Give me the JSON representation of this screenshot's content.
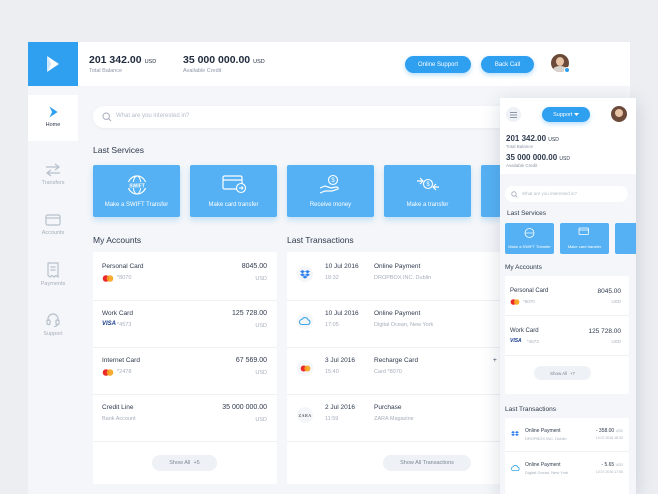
{
  "topbar": {
    "total_balance_value": "201 342.00",
    "total_balance_currency": "USD",
    "total_balance_label": "Total Balance",
    "available_credit_value": "35 000 000.00",
    "available_credit_currency": "USD",
    "available_credit_label": "Available Credit",
    "online_support_label": "Online Support",
    "back_call_label": "Back Call"
  },
  "sidebar": {
    "items": [
      {
        "label": "Home",
        "icon": "logo-icon"
      },
      {
        "label": "Transfers",
        "icon": "transfer-icon"
      },
      {
        "label": "Accounts",
        "icon": "card-icon"
      },
      {
        "label": "Payments",
        "icon": "receipt-icon"
      },
      {
        "label": "Support",
        "icon": "headset-icon"
      }
    ]
  },
  "search": {
    "placeholder": "What are you interested in?"
  },
  "services": {
    "title": "Last Services",
    "items": [
      {
        "label": "Make a SWIFT Transfer",
        "icon": "globe-icon"
      },
      {
        "label": "Make card transfer",
        "icon": "card-arrow-icon"
      },
      {
        "label": "Receive money",
        "icon": "hand-coin-icon"
      },
      {
        "label": "Make a transfer",
        "icon": "exchange-icon"
      }
    ]
  },
  "accounts": {
    "title": "My Accounts",
    "items": [
      {
        "name": "Personal Card",
        "number": "*8070",
        "amount": "8045.00",
        "currency": "USD",
        "brand": "mastercard"
      },
      {
        "name": "Work Card",
        "number": "*4573",
        "amount": "125 728.00",
        "currency": "USD",
        "brand": "visa"
      },
      {
        "name": "Internet Card",
        "number": "*2478",
        "amount": "67 569.00",
        "currency": "USD",
        "brand": "mastercard"
      },
      {
        "name": "Credit Line",
        "number": "Bank Account",
        "amount": "35 000 000.00",
        "currency": "USD",
        "brand": "none"
      }
    ],
    "show_all_label": "Show All",
    "show_all_count": "+5"
  },
  "transactions": {
    "title": "Last Transactions",
    "items": [
      {
        "date": "10 Jul 2016",
        "time": "18:32",
        "title": "Online Payment",
        "desc": "DROPBOX INC. Dublin",
        "icon": "dropbox-icon"
      },
      {
        "date": "10 Jul 2016",
        "time": "17:05",
        "title": "Online Payment",
        "desc": "Digital Ocean, New York",
        "icon": "cloud-icon"
      },
      {
        "date": "3 Jul 2016",
        "time": "15:40",
        "title": "Recharge Card",
        "desc": "Card *8070",
        "icon": "mastercard-icon"
      },
      {
        "date": "2 Jul 2016",
        "time": "11:59",
        "title": "Purchase",
        "desc": "ZARA Magazine",
        "icon": "zara-logo"
      }
    ],
    "recharge_sign": "+",
    "zara_text": "ZARA",
    "show_all_label": "Show All Transactions"
  },
  "mobile": {
    "support_label": "Support",
    "total_balance_value": "201 342.00",
    "total_balance_currency": "USD",
    "total_balance_label": "Total Balance",
    "available_credit_value": "35 000 000.00",
    "available_credit_currency": "USD",
    "available_credit_label": "Available Credit",
    "search_placeholder": "What are you interested in?",
    "services_title": "Last Services",
    "services": [
      "Make a SWIFT Transfer",
      "Make card transfer"
    ],
    "accounts_title": "My Accounts",
    "accounts": [
      {
        "name": "Personal Card",
        "number": "*8070",
        "amount": "8045.00",
        "currency": "USD"
      },
      {
        "name": "Work Card",
        "number": "*4573",
        "amount": "125 728.00",
        "currency": "USD"
      }
    ],
    "show_all_label": "Show All",
    "show_all_count": "+7",
    "transactions_title": "Last Transactions",
    "transactions": [
      {
        "title": "Online Payment",
        "desc": "DROPBOX INC. Dublin",
        "amount": "- 358.00",
        "currency": "USD",
        "date": "10.07.2016 18:32"
      },
      {
        "title": "Online Payment",
        "desc": "Digital Ocean, New York",
        "amount": "- 5.65",
        "currency": "USD",
        "date": "10.07.2016 17:05"
      }
    ]
  },
  "colors": {
    "accent": "#2f9ff0",
    "tile": "#55b1f3",
    "background": "#f4f6f9"
  }
}
